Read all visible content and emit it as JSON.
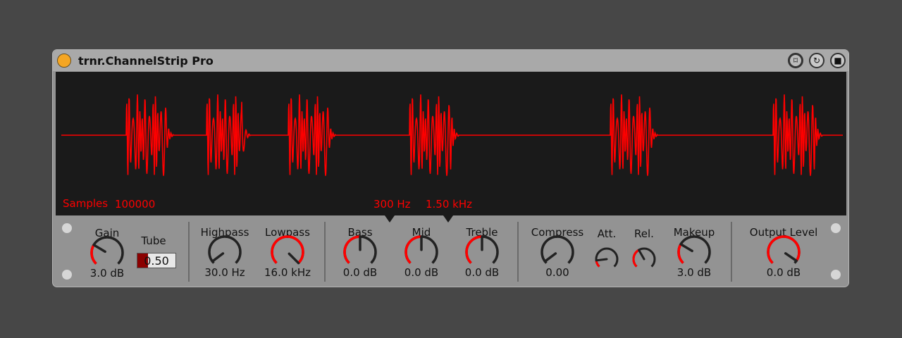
{
  "title": "trnr.ChannelStrip Pro",
  "title_buttons": [
    {
      "icon": "freeze-icon",
      "glyph": "⌑"
    },
    {
      "icon": "refresh-icon",
      "glyph": "↻"
    },
    {
      "icon": "save-icon",
      "glyph": "■"
    }
  ],
  "display": {
    "samples_label": "Samples",
    "samples_value": "100000",
    "bass_freq": "300 Hz",
    "mid_freq": "1.50 kHz"
  },
  "colors": {
    "accent": "#ff0000",
    "power": "#f5a623",
    "display_bg": "#1a1a1a"
  },
  "tube": {
    "label": "Tube",
    "value": "0.50",
    "fraction": 0.5
  },
  "knobs": [
    {
      "id": "gain",
      "label": "Gain",
      "value": "3.0 dB",
      "fraction": 0.28
    },
    {
      "id": "highpass",
      "label": "Highpass",
      "value": "30.0 Hz",
      "fraction": 0.03
    },
    {
      "id": "lowpass",
      "label": "Lowpass",
      "value": "16.0 kHz",
      "fraction": 1.0
    },
    {
      "id": "bass",
      "label": "Bass",
      "value": "0.0 dB",
      "fraction": 0.5
    },
    {
      "id": "mid",
      "label": "Mid",
      "value": "0.0 dB",
      "fraction": 0.5
    },
    {
      "id": "treble",
      "label": "Treble",
      "value": "0.0 dB",
      "fraction": 0.5
    },
    {
      "id": "compress",
      "label": "Compress",
      "value": "0.00",
      "fraction": 0.03
    },
    {
      "id": "att",
      "label": "Att.",
      "value": "",
      "fraction": 0.14
    },
    {
      "id": "rel",
      "label": "Rel.",
      "value": "",
      "fraction": 0.39
    },
    {
      "id": "makeup",
      "label": "Makeup",
      "value": "3.0 dB",
      "fraction": 0.28
    },
    {
      "id": "output",
      "label": "Output Level",
      "value": "0.0 dB",
      "fraction": 0.96
    }
  ]
}
